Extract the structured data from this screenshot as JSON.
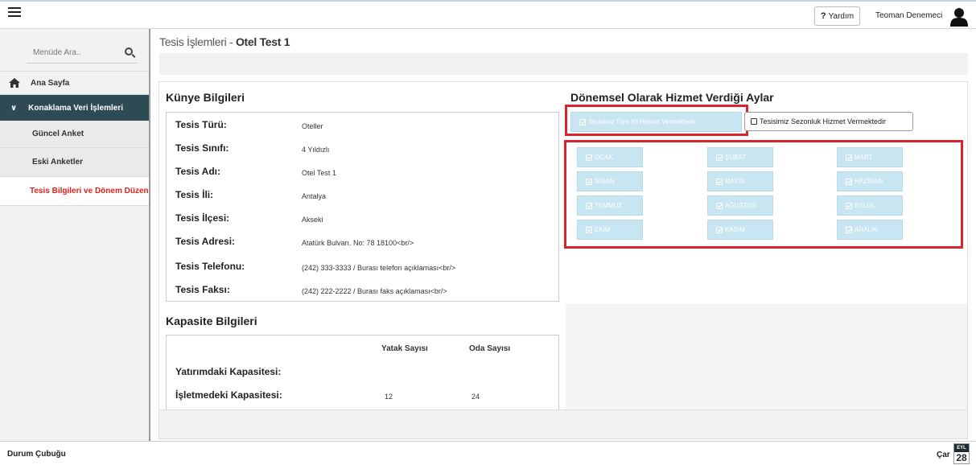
{
  "topbar": {
    "help_label": "Yardım",
    "help_mark": "?",
    "user_name": "Teoman Denemeci"
  },
  "sidebar": {
    "search_placeholder": "Menüde Ara..",
    "items": [
      {
        "label": "Ana Sayfa",
        "icon": "home-icon"
      },
      {
        "label": "Konaklama Veri İşlemleri",
        "icon": "chevron-down-icon",
        "expanded": true
      },
      {
        "label": "Güncel Anket"
      },
      {
        "label": "Eski Anketler"
      },
      {
        "label": "Tesis Bilgileri ve Dönem Düzenleme",
        "active": true
      }
    ]
  },
  "header": {
    "title_prefix": "Tesis İşlemleri - ",
    "title_name": "Otel Test 1"
  },
  "kunye": {
    "title": "Künye Bilgileri",
    "rows": [
      {
        "label": "Tesis Türü:",
        "value": "Oteller"
      },
      {
        "label": "Tesis Sınıfı:",
        "value": "4 Yıldızlı"
      },
      {
        "label": "Tesis Adı:",
        "value": "Otel Test 1"
      },
      {
        "label": "Tesis İli:",
        "value": "Antalya"
      },
      {
        "label": "Tesis İlçesi:",
        "value": "Akseki"
      },
      {
        "label": "Tesis Adresi:",
        "value": "Atatürk Bulvarı. No: 78 18100<br/>"
      },
      {
        "label": "Tesis Telefonu:",
        "value": "(242) 333-3333 / Burası telefon açıklaması<br/>"
      },
      {
        "label": "Tesis Faksı:",
        "value": "(242) 222-2222 / Burası faks açıklaması<br/>"
      }
    ]
  },
  "kapasite": {
    "title": "Kapasite Bilgileri",
    "col_beds": "Yatak Sayısı",
    "col_rooms": "Oda Sayısı",
    "rows": [
      {
        "label": "Yatırımdaki Kapasitesi:",
        "beds": "",
        "rooms": ""
      },
      {
        "label": "İşletmedeki Kapasitesi:",
        "beds": "12",
        "rooms": "24"
      }
    ]
  },
  "donem": {
    "title": "Dönemsel Olarak Hizmet Verdiği Aylar",
    "year_round_label": "Tesisimiz Tüm Yıl Hizmet Vermektedir",
    "seasonal_label": "Tesisimiz Sezonluk Hizmet Vermektedir",
    "months": [
      "OCAK",
      "ŞUBAT",
      "MART",
      "NİSAN",
      "MAYIS",
      "HAZİRAN",
      "TEMMUZ",
      "AĞUSTOS",
      "EYLÜL",
      "EKİM",
      "KASIM",
      "ARALIK"
    ],
    "highlight_color": "#d9232d",
    "button_color": "#c8e6f2"
  },
  "statusbar": {
    "label": "Durum Çubuğu",
    "day_name": "Çar",
    "cal_month": "EYL",
    "cal_day": "28"
  }
}
